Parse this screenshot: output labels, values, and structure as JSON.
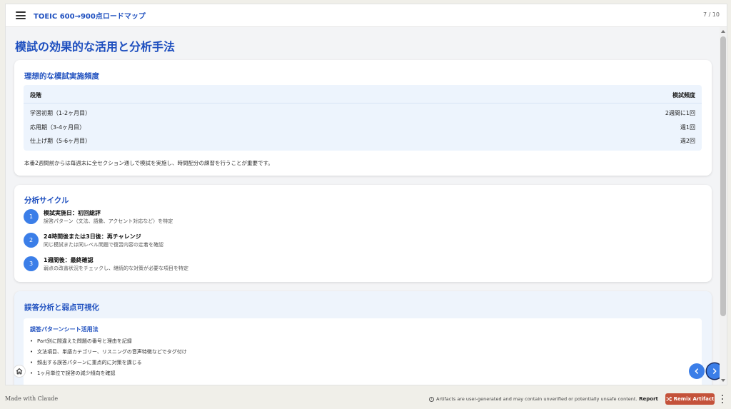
{
  "header": {
    "title": "TOEIC 600→900点ロードマップ",
    "page_count": "7 / 10"
  },
  "page": {
    "heading": "模試の効果的な活用と分析手法"
  },
  "frequency": {
    "title": "理想的な模試実施頻度",
    "columns": [
      "段階",
      "模試頻度"
    ],
    "rows": [
      [
        "学習初期（1-2ヶ月目）",
        "2週間に1回"
      ],
      [
        "応用期（3-4ヶ月目）",
        "週1回"
      ],
      [
        "仕上げ期（5-6ヶ月目）",
        "週2回"
      ]
    ],
    "note": "本番2週間前からは毎週末に全セクション通しで模試を実施し、時間配分の練習を行うことが重要です。"
  },
  "cycle": {
    "title": "分析サイクル",
    "steps": [
      {
        "num": "1",
        "title": "模試実施日：初回総評",
        "desc": "誤答パターン（文法、語彙、アクセント対応など）を特定"
      },
      {
        "num": "2",
        "title": "24時間後または3日後：再チャレンジ",
        "desc": "同じ模試または同レベル問題で復習内容の定着を確認"
      },
      {
        "num": "3",
        "title": "1週間後：最終確認",
        "desc": "弱点の改善状況をチェックし、継続的な対策が必要な項目を特定"
      }
    ]
  },
  "analysis": {
    "title": "誤答分析と弱点可視化",
    "sheet_title": "誤答パターンシート活用法",
    "bullets": [
      "Part別に間違えた問題の番号と理由を記録",
      "文法項目、単語カテゴリー、リスニングの音声特徴などでタグ付け",
      "頻出する誤答パターンに重点的に対策を講じる",
      "1ヶ月単位で誤答の減少傾向を確認"
    ]
  },
  "footer": {
    "made_with": "Made with Claude",
    "disclaimer": "Artifacts are user-generated and may contain unverified or potentially unsafe content.",
    "report_label": "Report",
    "remix_label": "Remix Artifact"
  },
  "colors": {
    "accent": "#1e4fbf",
    "step_circle": "#3b7ee8",
    "remix": "#c4523a"
  }
}
